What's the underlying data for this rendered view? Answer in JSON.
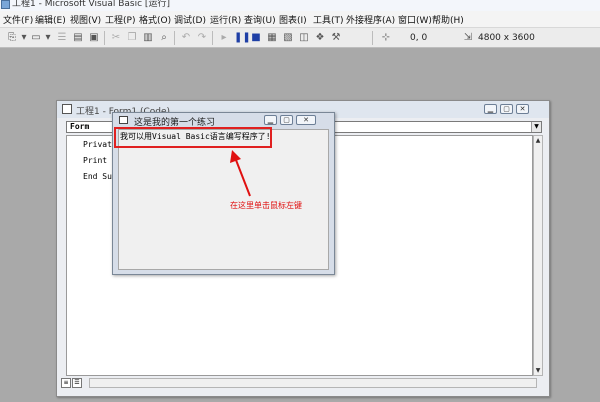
{
  "window": {
    "title": "工程1 - Microsoft Visual Basic [运行]"
  },
  "menu": [
    "文件(F)",
    "编辑(E)",
    "视图(V)",
    "工程(P)",
    "格式(O)",
    "调试(D)",
    "运行(R)",
    "查询(U)",
    "图表(I)",
    "工具(T)",
    "外接程序(A)",
    "窗口(W)",
    "帮助(H)"
  ],
  "toolbar": {
    "position": "0, 0",
    "size": "4800 x 3600"
  },
  "code_window": {
    "title": "工程1 - Form1 (Code)",
    "object_combo": "Form",
    "lines": [
      "Private",
      "Print \"",
      "End Sub"
    ]
  },
  "form_window": {
    "title": "这是我的第一个练习",
    "printed_text": "我可以用Visual Basic语言编写程序了!"
  },
  "annotation": {
    "text": "在这里单击鼠标左键",
    "color": "#e01010"
  }
}
